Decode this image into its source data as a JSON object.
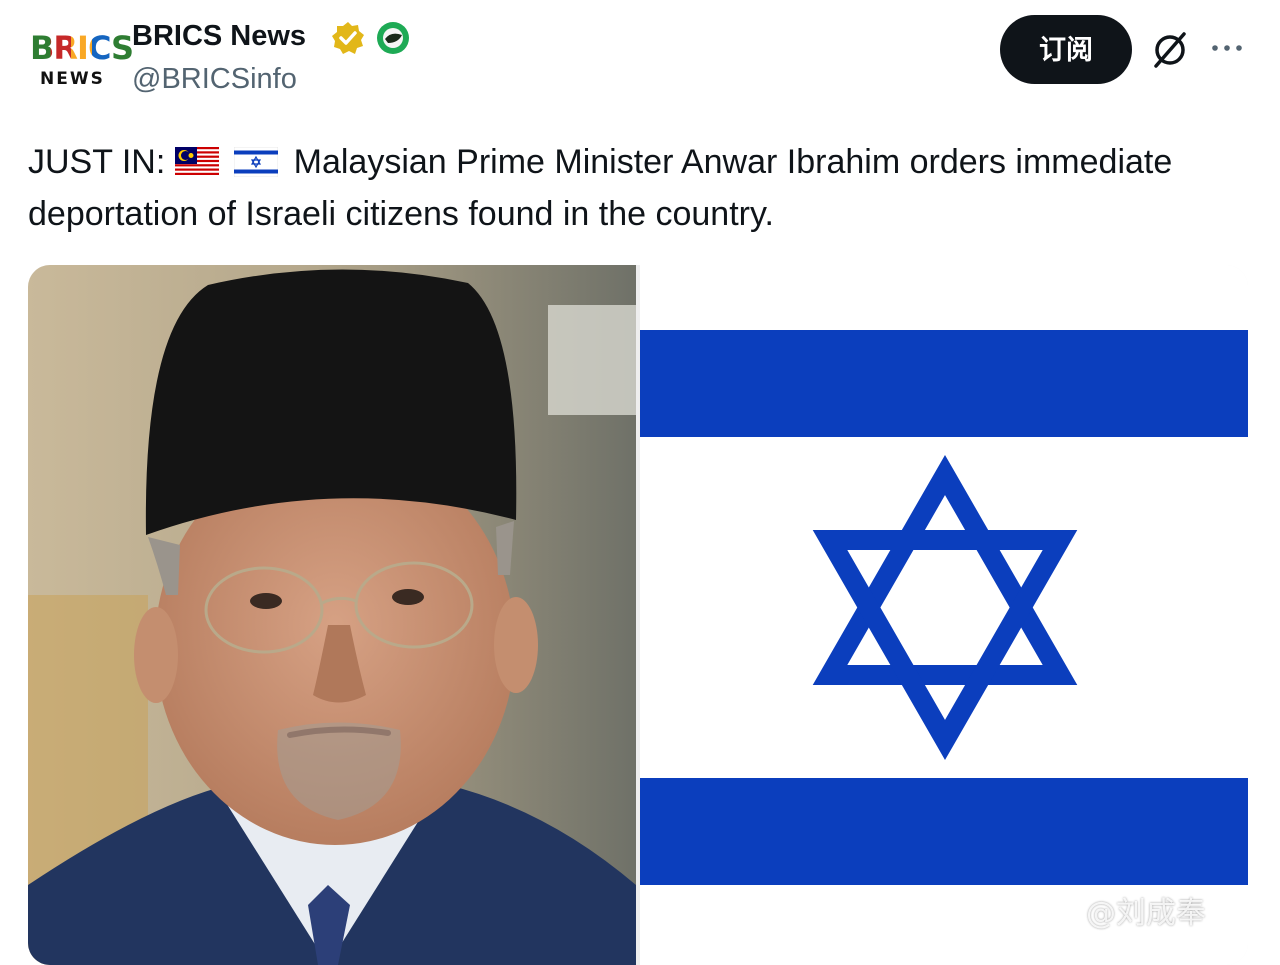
{
  "author": {
    "avatar_top": "BRICS",
    "avatar_bottom": "NEWS",
    "name": "BRICS News",
    "handle": "@BRICSinfo"
  },
  "actions": {
    "subscribe_label": "订阅"
  },
  "tweet": {
    "text_prefix": "JUST IN:",
    "flags": [
      "malaysia-flag",
      "israel-flag"
    ],
    "text_body": "Malaysian Prime Minister Anwar Ibrahim orders immediate deportation of Israeli citizens found in the country."
  },
  "media": [
    {
      "kind": "photo",
      "subject": "man-in-songkok"
    },
    {
      "kind": "photo",
      "subject": "israel-flag"
    }
  ],
  "watermark": "@刘成奉",
  "colors": {
    "flag_blue": "#0b3ebd",
    "verified_gold": "#e2b719",
    "affiliate_green": "#1eaa55",
    "button_dark": "#0f1419"
  }
}
